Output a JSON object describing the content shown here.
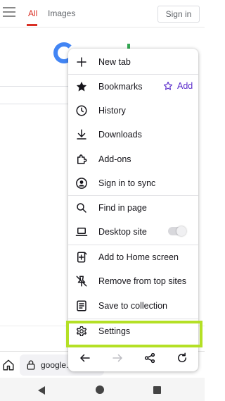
{
  "page": {
    "tabs": [
      {
        "label": "All",
        "active": true
      },
      {
        "label": "Images",
        "active": false
      }
    ],
    "sign_in_label": "Sign in"
  },
  "toolbar": {
    "url_text": "google.c"
  },
  "menu": {
    "items": [
      {
        "label": "New tab",
        "icon": "plus-icon"
      },
      {
        "label": "Bookmarks",
        "icon": "bookmark-star-icon",
        "action_label": "Add",
        "action_icon": "star-outline-icon"
      },
      {
        "label": "History",
        "icon": "clock-icon"
      },
      {
        "label": "Downloads",
        "icon": "download-icon"
      },
      {
        "label": "Add-ons",
        "icon": "puzzle-icon"
      },
      {
        "label": "Sign in to sync",
        "icon": "account-icon"
      },
      {
        "label": "Find in page",
        "icon": "search-icon"
      },
      {
        "label": "Desktop site",
        "icon": "laptop-icon",
        "toggle_on": false
      },
      {
        "label": "Add to Home screen",
        "icon": "add-to-home-icon"
      },
      {
        "label": "Remove from top sites",
        "icon": "unpin-icon"
      },
      {
        "label": "Save to collection",
        "icon": "collection-icon"
      },
      {
        "label": "Settings",
        "icon": "gear-icon"
      }
    ],
    "nav_icons": [
      "back-arrow-icon",
      "forward-arrow-icon",
      "share-icon",
      "reload-icon"
    ]
  },
  "colors": {
    "accent": "#592acb",
    "highlight": "#b4e025",
    "active_tab": "#d93025"
  }
}
